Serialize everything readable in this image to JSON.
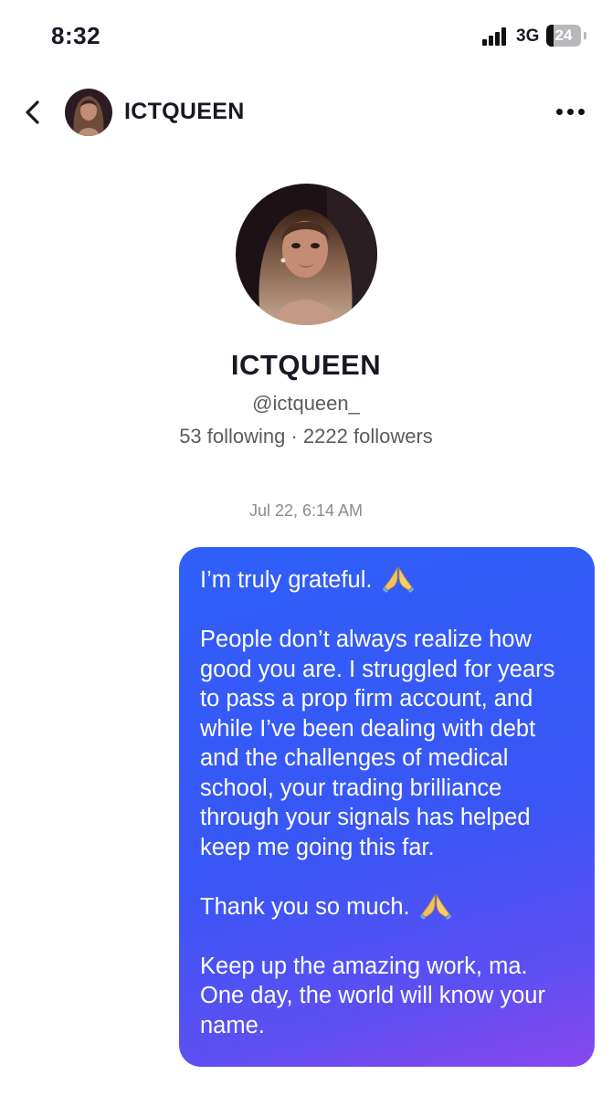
{
  "status_bar": {
    "time": "8:32",
    "network": "3G",
    "battery": "24"
  },
  "header": {
    "name": "ICTQUEEN",
    "back_icon": "chevron-left-icon",
    "more_icon": "more-horizontal-icon"
  },
  "profile": {
    "name": "ICTQUEEN",
    "handle": "@ictqueen_",
    "stats": "53 following · 2222 followers"
  },
  "conversation": {
    "timestamp": "Jul 22, 6:14 AM",
    "message": {
      "p1": "I’m truly grateful.",
      "p2": "People don’t always realize how good you are. I struggled for years to pass a prop firm account, and while I’ve been dealing with debt and the challenges of medical school, your trading brilliance through your signals has helped keep me going this far.",
      "p3": "Thank you so much.",
      "p4": "Keep up the amazing work, ma. One day, the world will know your name.",
      "emoji_icon": "praying-hands-icon"
    }
  },
  "colors": {
    "bubble_start": "#2f5ff8",
    "bubble_end": "#8947ee",
    "text_primary": "#161823",
    "text_secondary": "#5b5b60"
  }
}
